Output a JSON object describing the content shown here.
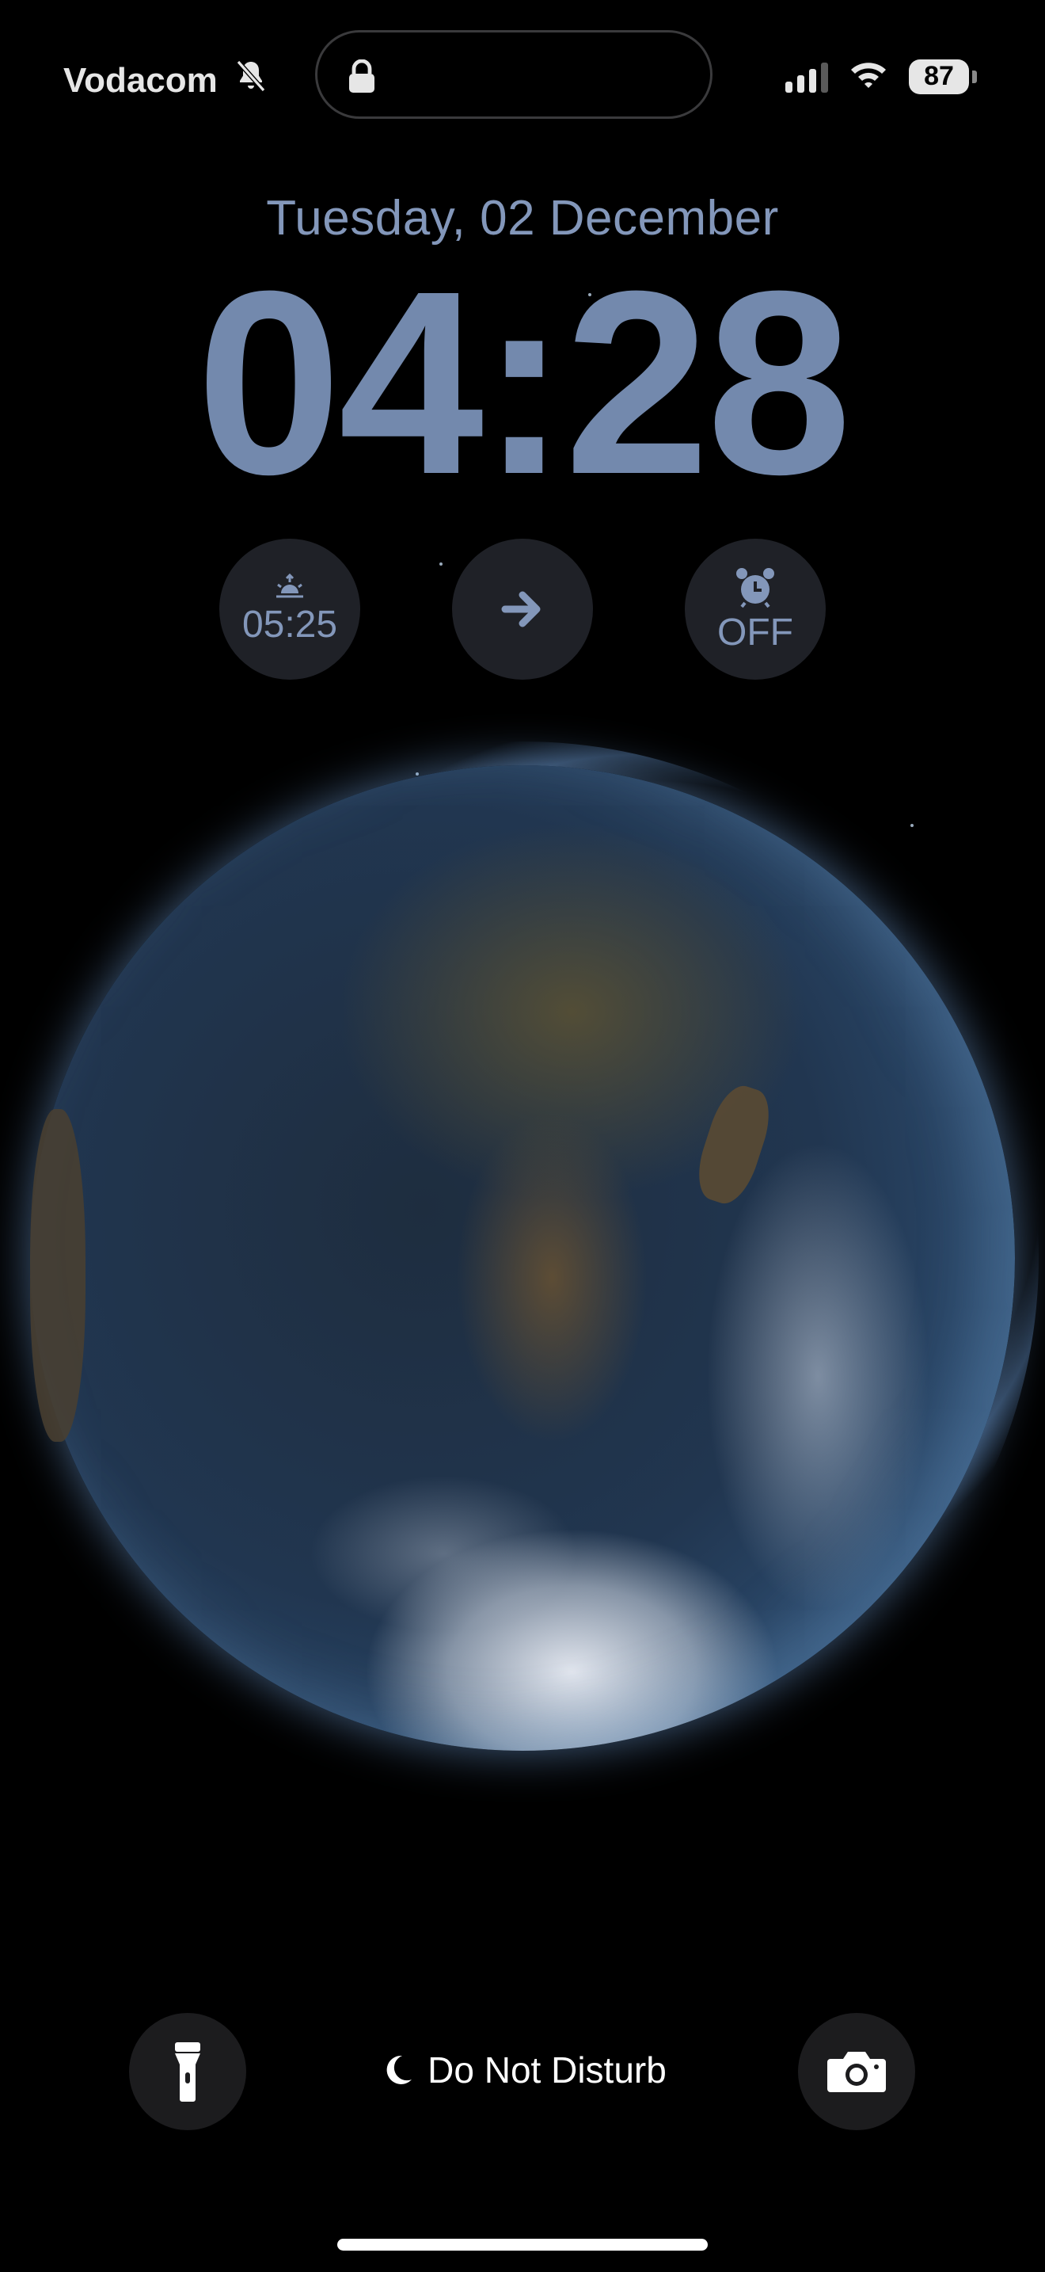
{
  "status_bar": {
    "carrier": "Vodacom",
    "battery": "87",
    "icons": [
      "bell-slash-icon",
      "lock-icon",
      "cellular-signal-icon",
      "wifi-icon",
      "battery-icon"
    ]
  },
  "lock_screen": {
    "date": "Tuesday, 02 December",
    "time": "04:28"
  },
  "widgets": [
    {
      "icon": "sunrise-icon",
      "label": "05:25"
    },
    {
      "icon": "arrow-right-icon",
      "label": ""
    },
    {
      "icon": "alarm-clock-icon",
      "label": "OFF"
    }
  ],
  "bottom": {
    "flashlight_icon": "flashlight-icon",
    "focus_icon": "moon-icon",
    "focus_label": "Do Not Disturb",
    "camera_icon": "camera-icon"
  },
  "colors": {
    "time_color": "#7389ad",
    "date_color": "#8397ba",
    "widget_bg": "#1f2127"
  }
}
